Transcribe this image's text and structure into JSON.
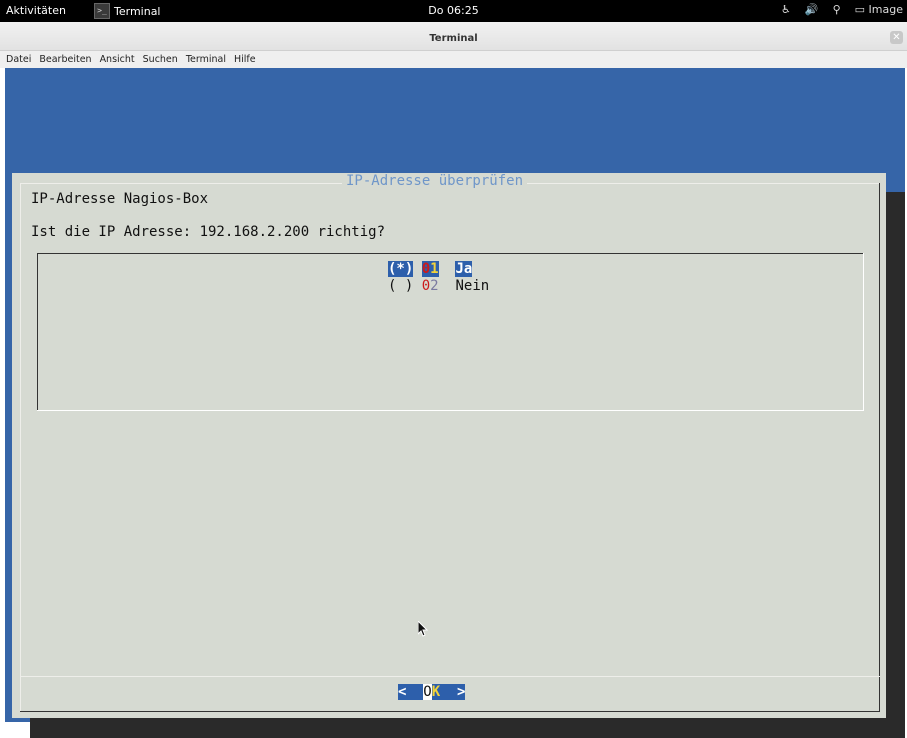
{
  "topbar": {
    "activities": "Aktivitäten",
    "app_name": "Terminal",
    "clock": "Do 06:25",
    "user": "Image"
  },
  "window": {
    "title": "Terminal"
  },
  "menu": {
    "items": [
      "Datei",
      "Bearbeiten",
      "Ansicht",
      "Suchen",
      "Terminal",
      "Hilfe"
    ]
  },
  "dialog": {
    "title": "IP-Adresse überprüfen",
    "line1": "IP-Adresse Nagios-Box",
    "line2": "Ist die IP Adresse: 192.168.2.200 richtig?",
    "options": [
      {
        "marker": "(*)",
        "tag_a": "0",
        "tag_b": "1",
        "label": "Ja"
      },
      {
        "marker": "( )",
        "tag_a": "0",
        "tag_b": "2",
        "label": "Nein"
      }
    ],
    "ok": {
      "left": "<  ",
      "o": "O",
      "k": "K",
      "right": "  >"
    }
  },
  "colors": {
    "terminal_bg": "#3665a8",
    "dialog_bg": "#d6dad2",
    "highlight": "#2d5fab",
    "title_text": "#6f96c9"
  }
}
